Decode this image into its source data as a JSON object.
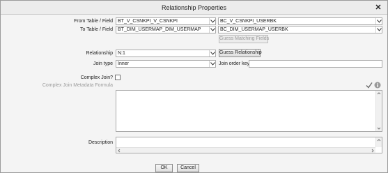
{
  "window": {
    "title": "Relationship Properties",
    "close_glyph": "✕"
  },
  "fields": {
    "from_label": "From Table / Field",
    "from_table": "BT_V_CSNKPI_V_CSNKPI",
    "from_field": "BC_V_CSNKPI_USERBK",
    "to_label": "To Table / Field",
    "to_table": "BT_DIM_USERMAP_DIM_USERMAP",
    "to_field": "BC_DIM_USERMAP_USERBK",
    "guess_matching_fields": "Guess Matching Fields",
    "relationship_label": "Relationship",
    "relationship_value": "N:1",
    "guess_relationship": "Guess Relationship",
    "join_type_label": "Join type",
    "join_type_value": "Inner",
    "join_order_key_label": "Join order key",
    "join_order_key_value": "",
    "complex_join_label": "Complex Join?",
    "complex_join_checked": false,
    "complex_join_formula_label": "Complex Join Metadata Formula",
    "complex_join_formula_value": "",
    "description_label": "Description",
    "description_value": ""
  },
  "footer": {
    "ok": "OK",
    "cancel": "Cancel"
  },
  "icons": {
    "validate": "check-icon",
    "info": "info-icon"
  },
  "colors": {
    "disabled_text": "#9a9a9a",
    "check_icon": "#6b6b6b"
  }
}
